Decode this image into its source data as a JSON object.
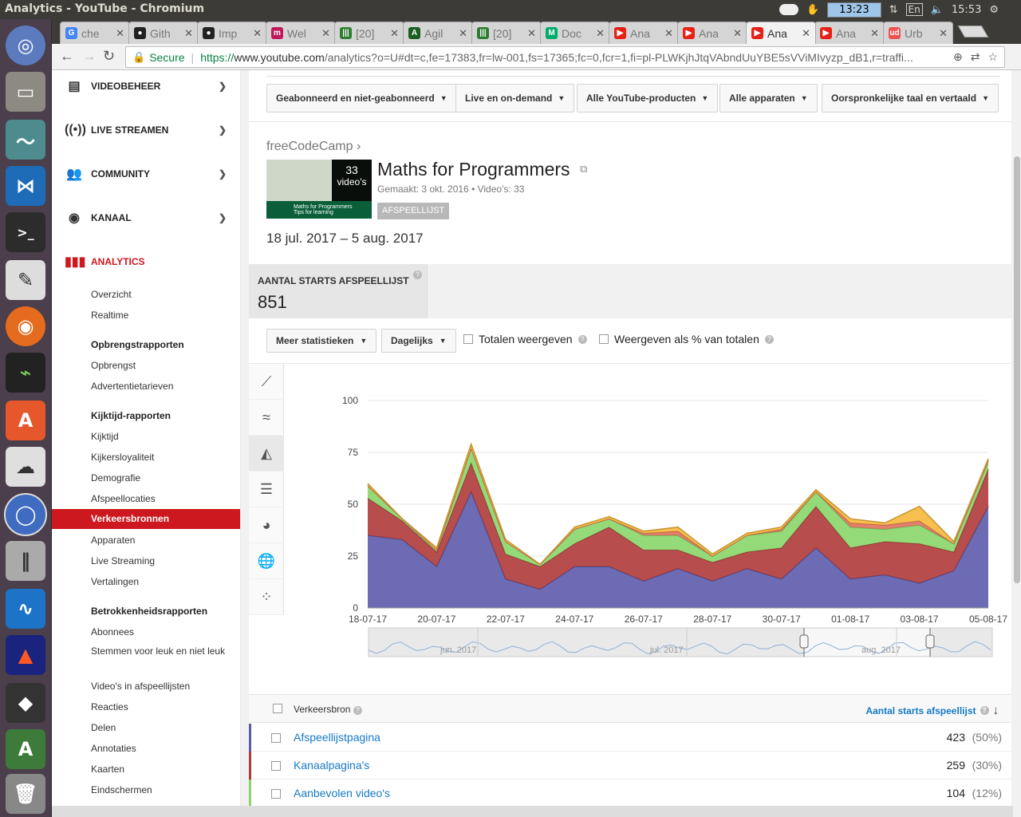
{
  "os": {
    "window_title": "Analytics - YouTube - Chromium",
    "clock_box": "13:23",
    "keyboard": "En",
    "time": "15:53"
  },
  "tabs": [
    {
      "label": "che",
      "icon": "google-icon",
      "color": "#4285f4",
      "glyph": "G"
    },
    {
      "label": "Gith",
      "icon": "github-icon",
      "color": "#222222",
      "glyph": "●"
    },
    {
      "label": "Imp",
      "icon": "github-icon",
      "color": "#222222",
      "glyph": "●"
    },
    {
      "label": "Wel",
      "icon": "m-icon",
      "color": "#c2185b",
      "glyph": "m"
    },
    {
      "label": "[20]",
      "icon": "pipe-icon",
      "color": "#2e7d32",
      "glyph": "|||"
    },
    {
      "label": "Agil",
      "icon": "agile-icon",
      "color": "#1b5e20",
      "glyph": "A"
    },
    {
      "label": "[20]",
      "icon": "pipe-icon",
      "color": "#2e7d32",
      "glyph": "|||"
    },
    {
      "label": "Doc",
      "icon": "medium-icon",
      "color": "#00ab6c",
      "glyph": "M"
    },
    {
      "label": "Ana",
      "icon": "youtube-icon",
      "color": "#e62117",
      "glyph": "▶"
    },
    {
      "label": "Ana",
      "icon": "youtube-icon",
      "color": "#e62117",
      "glyph": "▶"
    },
    {
      "label": "Ana",
      "icon": "youtube-icon",
      "color": "#e62117",
      "glyph": "▶"
    },
    {
      "label": "Ana",
      "icon": "youtube-icon",
      "color": "#e62117",
      "glyph": "▶"
    },
    {
      "label": "Urb",
      "icon": "udemy-icon",
      "color": "#ec5252",
      "glyph": "ud"
    }
  ],
  "active_tab_index": 10,
  "address": {
    "secure_label": "Secure",
    "url_prefix": "https://",
    "url_host": "www.youtube.com",
    "url_path": "/analytics?o=U#dt=c,fe=17383,fr=lw-001,fs=17365;fc=0,fcr=1,fi=pl-PLWKjhJtqVAbndUuYBE5sVViMIvyzp_dB1,r=traffi..."
  },
  "sidebar": {
    "sections": [
      {
        "label": "VIDEOBEHEER",
        "icon": "video-manager-icon"
      },
      {
        "label": "LIVE STREAMEN",
        "icon": "live-icon"
      },
      {
        "label": "COMMUNITY",
        "icon": "people-icon"
      },
      {
        "label": "KANAAL",
        "icon": "account-icon"
      },
      {
        "label": "ANALYTICS",
        "icon": "analytics-icon"
      }
    ],
    "items": [
      "Overzicht",
      "Realtime",
      "Opbrengstrapporten",
      "Opbrengst",
      "Advertentietarieven",
      "Kijktijd-rapporten",
      "Kijktijd",
      "Kijkersloyaliteit",
      "Demografie",
      "Afspeellocaties",
      "Verkeersbronnen",
      "Apparaten",
      "Live Streaming",
      "Vertalingen",
      "Betrokkenheidsrapporten",
      "Abonnees",
      "Stemmen voor leuk en niet leuk",
      "Video's in afspeellijsten",
      "Reacties",
      "Delen",
      "Annotaties",
      "Kaarten",
      "Eindschermen"
    ]
  },
  "filters": [
    "Geabonneerd en niet-geabonneerd",
    "Live en on-demand",
    "Alle YouTube-producten",
    "Alle apparaten",
    "Oorspronkelijke taal en vertaald"
  ],
  "playlist": {
    "channel": "freeCodeCamp",
    "title": "Maths for Programmers",
    "thumb_count": "33",
    "thumb_count_label": "video's",
    "thumb_strip_text": "Maths for Programmers",
    "thumb_strip_sub": "Tips for learning",
    "meta": "Gemaakt: 3 okt. 2016  •  Video's: 33",
    "badge": "AFSPEELLIJST",
    "date_range": "18 jul. 2017 – 5 aug. 2017"
  },
  "metric": {
    "label": "AANTAL STARTS AFSPEELLIJST",
    "value": "851"
  },
  "controls": {
    "more_stats": "Meer statistieken",
    "granularity": "Dagelijks",
    "show_totals": "Totalen weergeven",
    "show_percent": "Weergeven als % van totalen"
  },
  "chart_types": [
    "line-chart-icon",
    "multiline-chart-icon",
    "stacked-area-icon",
    "bar-chart-icon",
    "pie-chart-icon",
    "map-icon",
    "bubble-chart-icon"
  ],
  "chart_data": {
    "type": "area",
    "stacked": true,
    "x": [
      "18-07-17",
      "19-07-17",
      "20-07-17",
      "21-07-17",
      "22-07-17",
      "23-07-17",
      "24-07-17",
      "25-07-17",
      "26-07-17",
      "27-07-17",
      "28-07-17",
      "29-07-17",
      "30-07-17",
      "31-07-17",
      "01-08-17",
      "02-08-17",
      "03-08-17",
      "04-08-17",
      "05-08-17"
    ],
    "x_tick_labels": [
      "18-07-17",
      "20-07-17",
      "22-07-17",
      "24-07-17",
      "26-07-17",
      "28-07-17",
      "30-07-17",
      "01-08-17",
      "03-08-17",
      "05-08-17"
    ],
    "ylim": [
      0,
      100
    ],
    "y_ticks": [
      0,
      25,
      50,
      75,
      100
    ],
    "grid": true,
    "series": [
      {
        "color": "#5c5bab",
        "values": [
          35,
          33,
          20,
          56,
          14,
          9,
          20,
          20,
          13,
          19,
          13,
          19,
          14,
          29,
          14,
          16,
          12,
          18,
          49
        ]
      },
      {
        "color": "#b03a3a",
        "values": [
          18,
          9,
          7,
          14,
          12,
          11,
          11,
          19,
          15,
          9,
          9,
          8,
          15,
          20,
          15,
          16,
          19,
          9,
          18
        ]
      },
      {
        "color": "#8ad66a",
        "values": [
          6,
          1,
          1,
          7,
          6,
          1,
          7,
          4,
          7,
          7,
          3,
          8,
          8,
          7,
          10,
          6,
          9,
          4,
          4
        ]
      },
      {
        "color": "#e0725c",
        "values": [
          0,
          0,
          0,
          0,
          0,
          0,
          0,
          0,
          1,
          2,
          0,
          0,
          1,
          0,
          2,
          2,
          2,
          0,
          0
        ]
      },
      {
        "color": "#f6b93b",
        "values": [
          1,
          0,
          1,
          2,
          1,
          0,
          1,
          1,
          1,
          2,
          1,
          1,
          1,
          1,
          2,
          1,
          7,
          1,
          1
        ]
      }
    ],
    "navigator_labels": [
      "jun. 2017",
      "jul. 2017",
      "aug. 2017"
    ]
  },
  "table": {
    "header_label": "Verkeersbron",
    "header_metric": "Aantal starts afspeellijst",
    "rows": [
      {
        "label": "Afspeellijstpagina",
        "value": "423",
        "pct": "(50%)",
        "color": "#5c5bab"
      },
      {
        "label": "Kanaalpagina's",
        "value": "259",
        "pct": "(30%)",
        "color": "#b03a3a"
      },
      {
        "label": "Aanbevolen video's",
        "value": "104",
        "pct": "(12%)",
        "color": "#8ad66a"
      }
    ]
  }
}
